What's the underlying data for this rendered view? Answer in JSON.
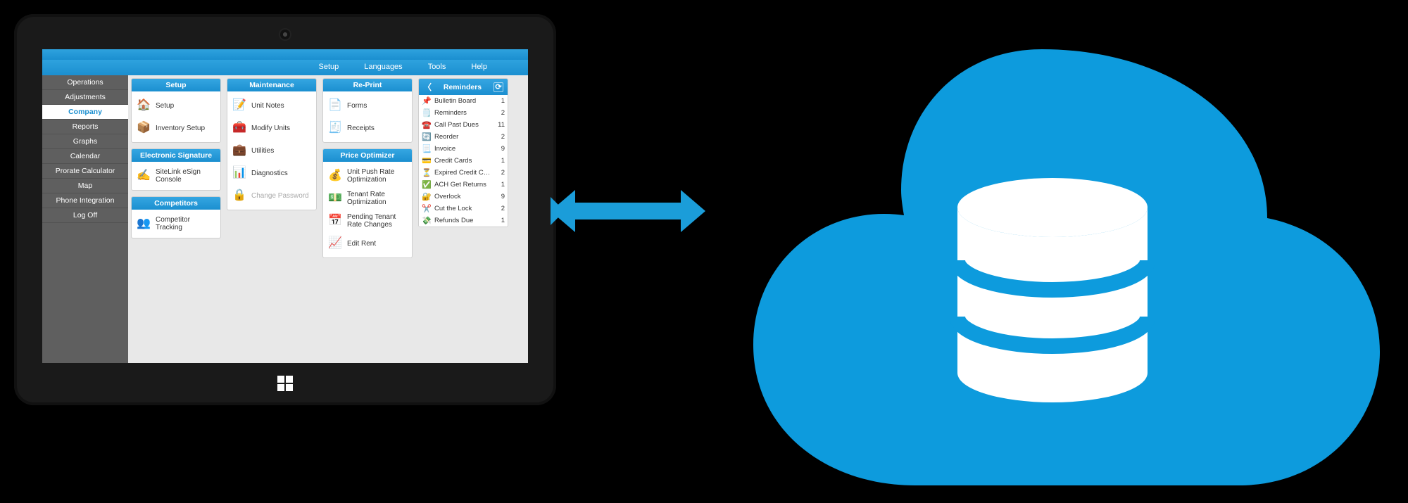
{
  "menubar": {
    "items": [
      "Setup",
      "Languages",
      "Tools",
      "Help"
    ]
  },
  "sidebar": {
    "items": [
      {
        "label": "Operations",
        "selected": false
      },
      {
        "label": "Adjustments",
        "selected": false
      },
      {
        "label": "Company",
        "selected": true
      },
      {
        "label": "Reports",
        "selected": false
      },
      {
        "label": "Graphs",
        "selected": false
      },
      {
        "label": "Calendar",
        "selected": false
      },
      {
        "label": "Prorate Calculator",
        "selected": false
      },
      {
        "label": "Map",
        "selected": false
      },
      {
        "label": "Phone Integration",
        "selected": false
      },
      {
        "label": "Log Off",
        "selected": false
      }
    ]
  },
  "columns": {
    "col1": [
      {
        "header": "Setup",
        "items": [
          {
            "icon": "🏠",
            "label": "Setup"
          },
          {
            "icon": "📦",
            "label": "Inventory Setup"
          }
        ]
      },
      {
        "header": "Electronic Signature",
        "items": [
          {
            "icon": "✍️",
            "label": "SiteLink eSign Console"
          }
        ]
      },
      {
        "header": "Competitors",
        "items": [
          {
            "icon": "👥",
            "label": "Competitor Tracking"
          }
        ]
      }
    ],
    "col2": [
      {
        "header": "Maintenance",
        "items": [
          {
            "icon": "📝",
            "label": "Unit Notes"
          },
          {
            "icon": "🧰",
            "label": "Modify Units"
          },
          {
            "icon": "💼",
            "label": "Utilities"
          },
          {
            "icon": "📊",
            "label": "Diagnostics"
          },
          {
            "icon": "🔒",
            "label": "Change Password",
            "disabled": true
          }
        ]
      }
    ],
    "col3": [
      {
        "header": "Re-Print",
        "items": [
          {
            "icon": "📄",
            "label": "Forms"
          },
          {
            "icon": "🧾",
            "label": "Receipts"
          }
        ]
      },
      {
        "header": "Price Optimizer",
        "items": [
          {
            "icon": "💰",
            "label": "Unit Push Rate Optimization"
          },
          {
            "icon": "💵",
            "label": "Tenant Rate Optimization"
          },
          {
            "icon": "📅",
            "label": "Pending Tenant Rate Changes"
          },
          {
            "icon": "📈",
            "label": "Edit Rent"
          }
        ]
      }
    ]
  },
  "reminders": {
    "header": "Reminders",
    "items": [
      {
        "icon": "📌",
        "label": "Bulletin Board",
        "count": 1
      },
      {
        "icon": "🗒️",
        "label": "Reminders",
        "count": 2
      },
      {
        "icon": "☎️",
        "label": "Call Past Dues",
        "count": 11
      },
      {
        "icon": "🔄",
        "label": "Reorder",
        "count": 2
      },
      {
        "icon": "📃",
        "label": "Invoice",
        "count": 9
      },
      {
        "icon": "💳",
        "label": "Credit Cards",
        "count": 1
      },
      {
        "icon": "⏳",
        "label": "Expired Credit Car...",
        "count": 2
      },
      {
        "icon": "✅",
        "label": "ACH Get Returns",
        "count": 1
      },
      {
        "icon": "🔐",
        "label": "Overlock",
        "count": 9
      },
      {
        "icon": "✂️",
        "label": "Cut the Lock",
        "count": 2
      },
      {
        "icon": "💸",
        "label": "Refunds Due",
        "count": 1
      }
    ]
  },
  "colors": {
    "accent": "#1b9dd9",
    "cloud": "#0d9bdd"
  }
}
